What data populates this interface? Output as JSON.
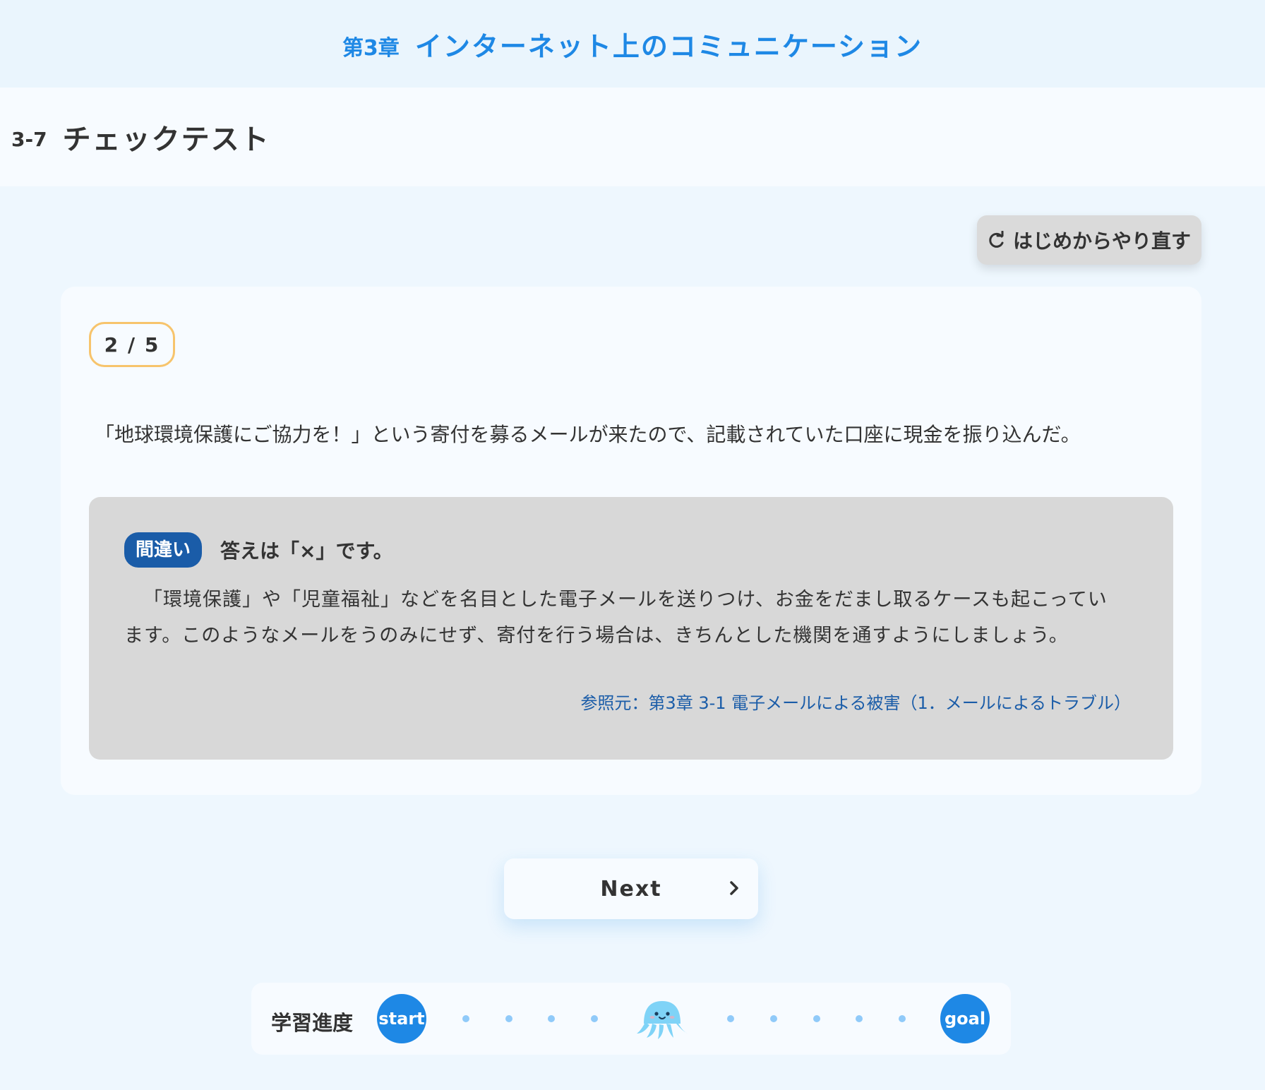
{
  "chapter": {
    "number": "第3章",
    "title": "インターネット上のコミュニケーション"
  },
  "section": {
    "number": "3-7",
    "title": "チェックテスト"
  },
  "restart_button": {
    "label": "はじめからやり直す",
    "icon": "refresh-icon"
  },
  "quiz": {
    "counter": "2 / 5",
    "question": "「地球環境保護にご協力を！」という寄付を募るメールが来たので、記載されていた口座に現金を振り込んだ。",
    "feedback": {
      "verdict": "間違い",
      "answer": "答えは「×」です。",
      "explanation": "「環境保護」や「児童福祉」などを名目とした電子メールを送りつけ、お金をだまし取るケースも起こっています。このようなメールをうのみにせず、寄付を行う場合は、きちんとした機関を通すようにしましょう。",
      "reference": "参照元：第3章 3-1 電子メールによる被害（1．メールによるトラブル）"
    }
  },
  "next_button": {
    "label": "Next",
    "icon": "chevron-right-icon"
  },
  "progress": {
    "label": "学習進度",
    "start_label": "start",
    "goal_label": "goal",
    "current_step": 5,
    "total_steps": 11,
    "mascot_icon": "jellyfish-icon"
  },
  "colors": {
    "accent": "#1e88e5",
    "verdict_badge": "#1a5ca8",
    "counter_border": "#f7c46c",
    "feedback_bg": "#d8d8d8",
    "page_bg": "#eef7fe"
  }
}
